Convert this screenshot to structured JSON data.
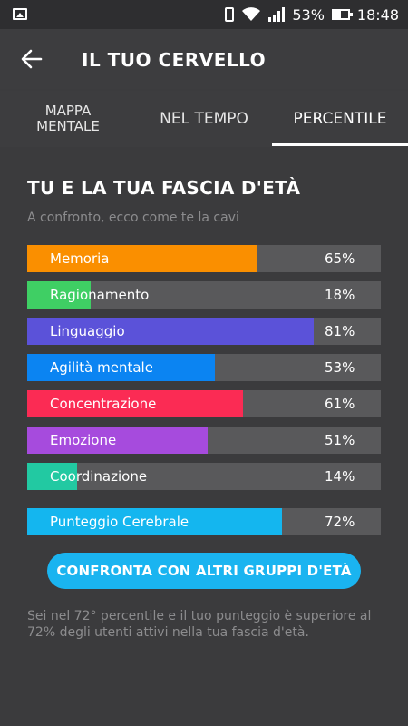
{
  "status_bar": {
    "battery": "53%",
    "time": "18:48"
  },
  "app_bar": {
    "title": "IL TUO CERVELLO"
  },
  "tabs": [
    {
      "label": "MAPPA\nMENTALE",
      "active": false
    },
    {
      "label": "NEL TEMPO",
      "active": false
    },
    {
      "label": "PERCENTILE",
      "active": true
    }
  ],
  "section": {
    "title": "TU E LA TUA FASCIA D'ETÀ",
    "subtitle": "A confronto, ecco come te la cavi"
  },
  "chart_data": {
    "type": "bar",
    "orientation": "horizontal",
    "categories": [
      "Memoria",
      "Ragionamento",
      "Linguaggio",
      "Agilità mentale",
      "Concentrazione",
      "Emozione",
      "Coordinazione",
      "Punteggio Cerebrale"
    ],
    "values": [
      65,
      18,
      81,
      53,
      61,
      51,
      14,
      72
    ],
    "value_labels": [
      "65%",
      "18%",
      "81%",
      "53%",
      "61%",
      "51%",
      "14%",
      "72%"
    ],
    "colors": [
      "#fa8f00",
      "#3fcf64",
      "#5b52d9",
      "#0b84f2",
      "#fb2b54",
      "#a64bdd",
      "#22c9a2",
      "#14b6ef"
    ],
    "xlim": [
      0,
      100
    ]
  },
  "cta": {
    "label": "CONFRONTA CON ALTRI GRUPPI D'ETÀ"
  },
  "footnote": "Sei nel 72° percentile e il tuo punteggio è superiore al 72% degli utenti attivi nella tua fascia d'età."
}
